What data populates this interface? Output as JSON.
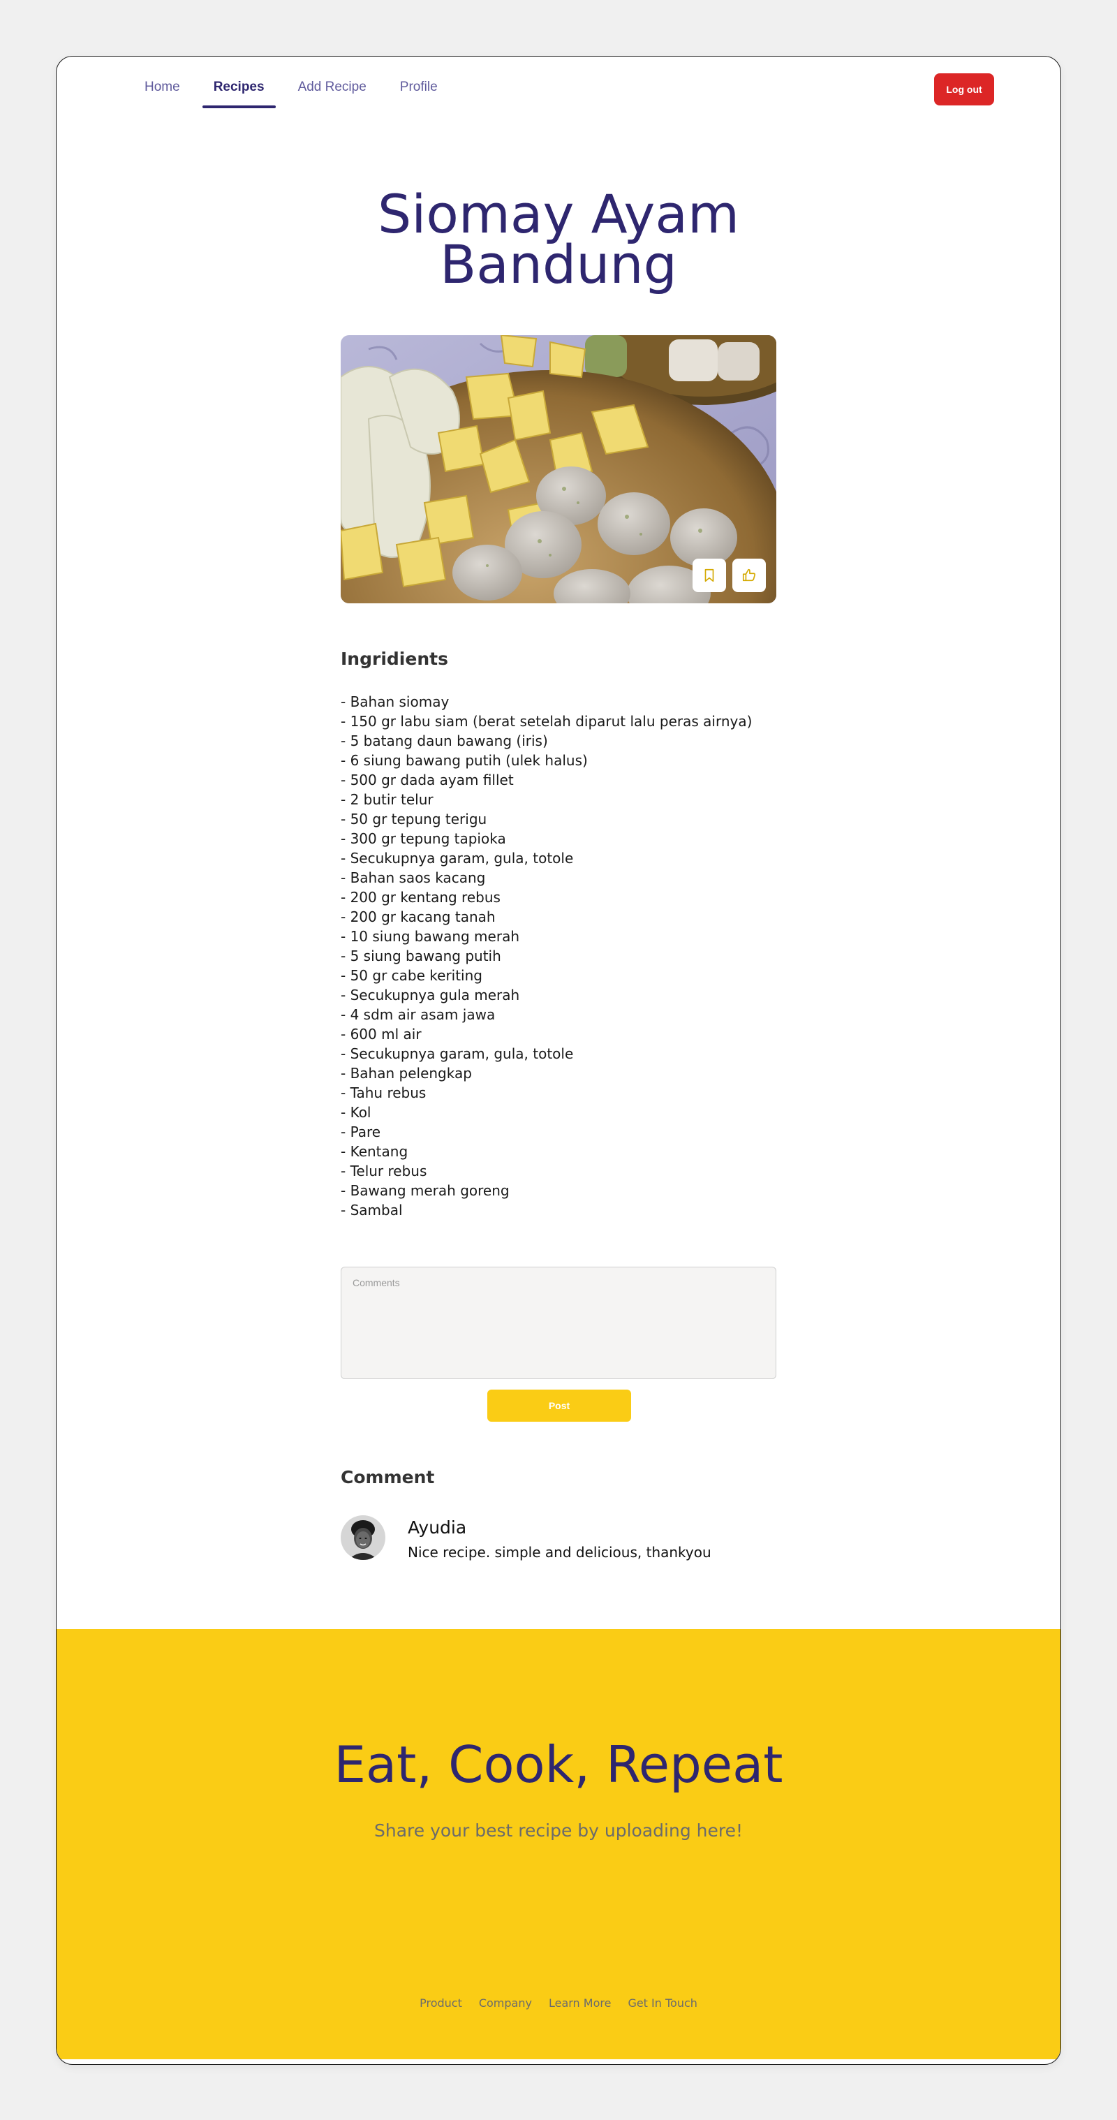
{
  "nav": {
    "items": [
      {
        "label": "Home",
        "active": false
      },
      {
        "label": "Recipes",
        "active": true
      },
      {
        "label": "Add Recipe",
        "active": false
      },
      {
        "label": "Profile",
        "active": false
      }
    ],
    "logout_label": "Log out"
  },
  "recipe": {
    "title_line1": "Siomay Ayam",
    "title_line2": "Bandung",
    "image_icons": [
      "bookmark-icon",
      "thumbs-up-icon"
    ],
    "ingredients_heading": "Ingridients",
    "ingredients": [
      "- Bahan siomay",
      "- 150 gr labu siam (berat setelah diparut lalu peras airnya)",
      "- 5 batang daun bawang (iris)",
      "- 6 siung bawang putih (ulek halus)",
      "- 500 gr dada ayam fillet",
      "- 2 butir telur",
      "- 50 gr tepung terigu",
      "- 300 gr tepung tapioka",
      "- Secukupnya garam, gula, totole",
      "- Bahan saos kacang",
      "- 200 gr kentang rebus",
      "- 200 gr kacang tanah",
      "- 10 siung bawang merah",
      "- 5 siung bawang putih",
      "- 50 gr cabe keriting",
      "- Secukupnya gula merah",
      "- 4 sdm air asam jawa",
      "- 600 ml air",
      "- Secukupnya garam, gula, totole",
      "- Bahan pelengkap",
      "- Tahu rebus",
      "- Kol",
      "- Pare",
      "- Kentang",
      "- Telur rebus",
      "- Bawang merah goreng",
      "- Sambal"
    ]
  },
  "comment_form": {
    "placeholder": "Comments",
    "post_label": "Post"
  },
  "comments": {
    "heading": "Comment",
    "items": [
      {
        "name": "Ayudia",
        "text": "Nice recipe. simple and delicious, thankyou"
      }
    ]
  },
  "footer": {
    "title": "Eat, Cook, Repeat",
    "subtitle": "Share your best recipe by uploading here!",
    "links": [
      "Product",
      "Company",
      "Learn More",
      "Get In Touch"
    ]
  },
  "colors": {
    "primary": "#2e266f",
    "accent": "#facc15",
    "danger": "#dc2626"
  }
}
